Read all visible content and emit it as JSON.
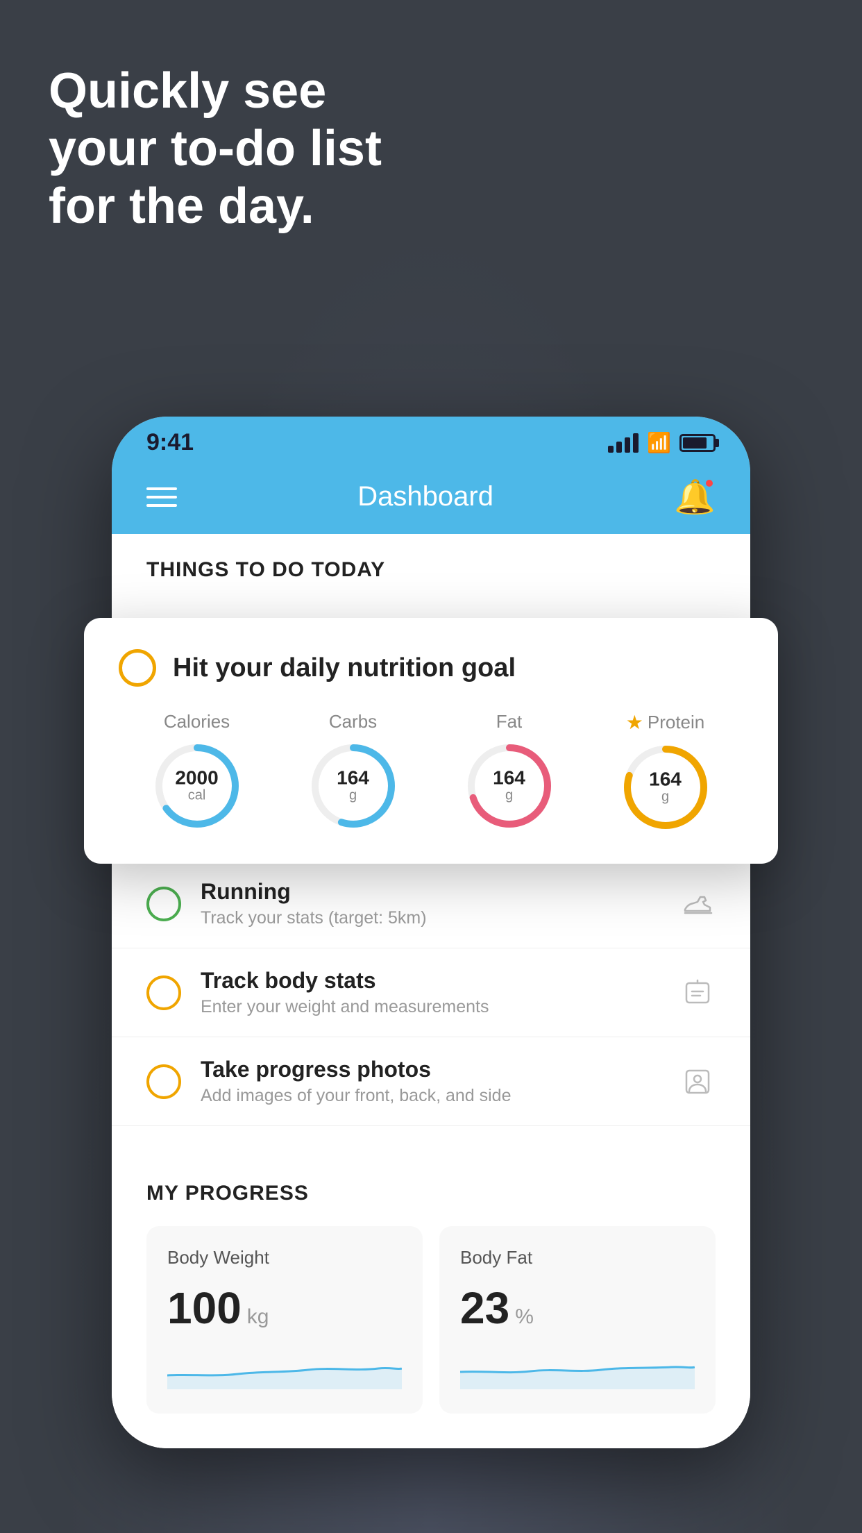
{
  "background": {
    "color": "#3a3f47"
  },
  "headline": {
    "line1": "Quickly see",
    "line2": "your to-do list",
    "line3": "for the day."
  },
  "phone": {
    "statusBar": {
      "time": "9:41"
    },
    "navBar": {
      "title": "Dashboard"
    },
    "sectionHeader": {
      "title": "THINGS TO DO TODAY"
    },
    "floatingCard": {
      "title": "Hit your daily nutrition goal",
      "nutrition": [
        {
          "label": "Calories",
          "value": "2000",
          "unit": "cal",
          "color": "#4db8e8",
          "pct": 0.65
        },
        {
          "label": "Carbs",
          "value": "164",
          "unit": "g",
          "color": "#4db8e8",
          "pct": 0.55
        },
        {
          "label": "Fat",
          "value": "164",
          "unit": "g",
          "color": "#e85c7a",
          "pct": 0.7
        },
        {
          "label": "Protein",
          "value": "164",
          "unit": "g",
          "color": "#f0a500",
          "pct": 0.8,
          "star": true
        }
      ]
    },
    "todoItems": [
      {
        "title": "Running",
        "subtitle": "Track your stats (target: 5km)",
        "circleColor": "green",
        "icon": "shoe"
      },
      {
        "title": "Track body stats",
        "subtitle": "Enter your weight and measurements",
        "circleColor": "yellow",
        "icon": "scale"
      },
      {
        "title": "Take progress photos",
        "subtitle": "Add images of your front, back, and side",
        "circleColor": "yellow",
        "icon": "person"
      }
    ],
    "progressSection": {
      "title": "MY PROGRESS",
      "cards": [
        {
          "title": "Body Weight",
          "value": "100",
          "unit": "kg"
        },
        {
          "title": "Body Fat",
          "value": "23",
          "unit": "%"
        }
      ]
    }
  }
}
